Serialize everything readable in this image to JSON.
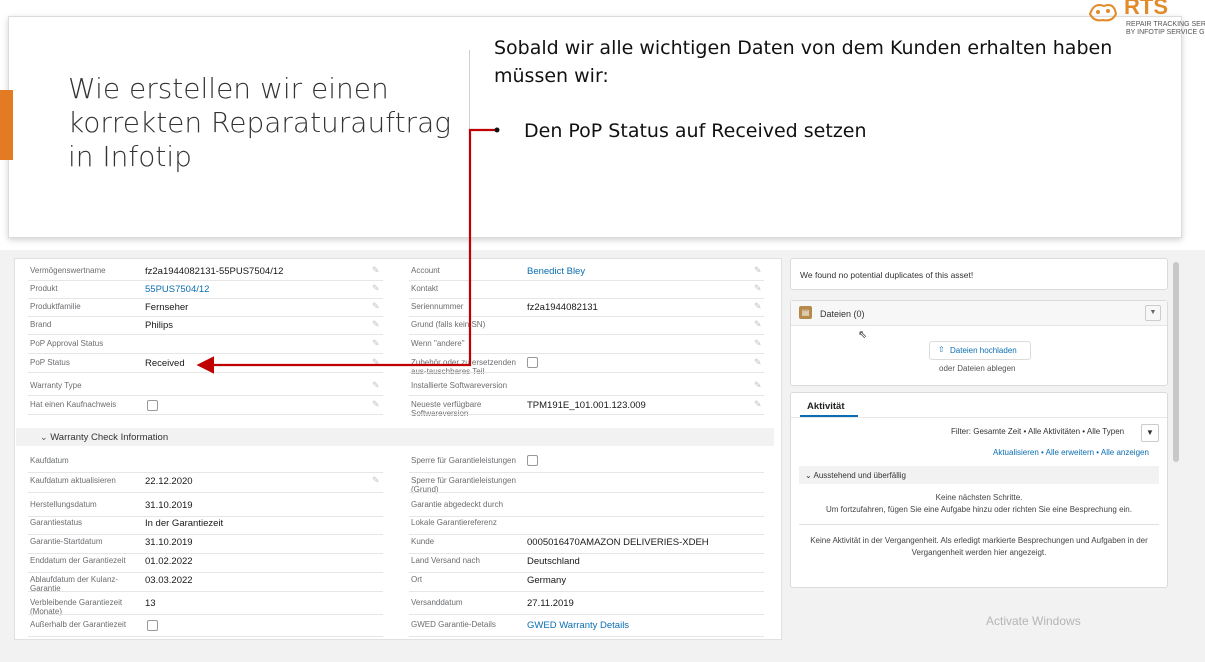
{
  "slide": {
    "title": "Wie erstellen wir einen korrekten Reparaturauftrag in Infotip",
    "intro_line1": "Sobald wir alle wichtigen Daten von dem Kunden erhalten haben",
    "intro_line2": "müssen wir:",
    "bullet": "Den PoP Status auf Received setzen",
    "accent_color": "#e37b24",
    "arrow_color": "#c00000"
  },
  "logo": {
    "name": "RTS",
    "line1": "REPAIR TRACKING SER",
    "line2": "BY INFOTIP SERVICE G"
  },
  "left_fields": [
    {
      "label": "Vermögenswertname",
      "value": "fz2a1944082131-55PUS7504/12"
    },
    {
      "label": "Produkt",
      "value": "55PUS7504/12",
      "link": true
    },
    {
      "label": "Produktfamilie",
      "value": "Fernseher"
    },
    {
      "label": "Brand",
      "value": "Philips"
    },
    {
      "label": "PoP Approval Status",
      "value": ""
    },
    {
      "label": "PoP Status",
      "value": "Received"
    },
    {
      "label": "Warranty Type",
      "value": ""
    },
    {
      "label": "Hat einen Kaufnachweis",
      "value": ""
    }
  ],
  "right_fields": [
    {
      "label": "Account",
      "value": "Benedict Bley",
      "link": true
    },
    {
      "label": "Kontakt",
      "value": ""
    },
    {
      "label": "Seriennummer",
      "value": "fz2a1944082131"
    },
    {
      "label": "Grund (falls kein SN)",
      "value": ""
    },
    {
      "label": "Wenn \"andere\"",
      "value": ""
    },
    {
      "label": "Zubehör oder zu ersetzenden aus-tauschbares Teil",
      "value": ""
    },
    {
      "label": "Installierte Softwareversion",
      "value": ""
    },
    {
      "label": "Neueste verfügbare Softwareversion",
      "value": "TPM191E_101.001.123.009"
    }
  ],
  "warranty_section": {
    "title": "Warranty Check Information",
    "left": [
      {
        "label": "Kaufdatum",
        "value": ""
      },
      {
        "label": "Kaufdatum aktualisieren",
        "value": "22.12.2020"
      },
      {
        "label": "Herstellungsdatum",
        "value": "31.10.2019"
      },
      {
        "label": "Garantiestatus",
        "value": "In der Garantiezeit"
      },
      {
        "label": "Garantie-Startdatum",
        "value": "31.10.2019"
      },
      {
        "label": "Enddatum der Garantiezeit",
        "value": "01.02.2022"
      },
      {
        "label": "Ablaufdatum der Kulanz-Garantie",
        "value": "03.03.2022"
      },
      {
        "label": "Verbleibende Garantiezeit (Monate)",
        "value": "13"
      },
      {
        "label": "Außerhalb der Garantiezeit",
        "value": ""
      }
    ],
    "right": [
      {
        "label": "Sperre für Garantieleistungen",
        "value": ""
      },
      {
        "label": "Sperre für Garantieleistungen (Grund)",
        "value": ""
      },
      {
        "label": "Garantie abgedeckt durch",
        "value": ""
      },
      {
        "label": "Lokale Garantiereferenz",
        "value": ""
      },
      {
        "label": "Kunde",
        "value": "0005016470AMAZON DELIVERIES-XDEH"
      },
      {
        "label": "Land Versand nach",
        "value": "Deutschland"
      },
      {
        "label": "Ort",
        "value": "Germany"
      },
      {
        "label": "Versanddatum",
        "value": "27.11.2019"
      },
      {
        "label": "GWED Garantie-Details",
        "value": "GWED Warranty Details",
        "link": true
      }
    ]
  },
  "sidebar": {
    "duplicates": "We found no potential duplicates of this asset!",
    "files_title": "Dateien (0)",
    "upload_button": "Dateien hochladen",
    "drop_text": "oder Dateien ablegen",
    "activity_tab": "Aktivität",
    "filter_text": "Filter: Gesamte Zeit • Alle Aktivitäten • Alle Typen",
    "links": "Aktualisieren • Alle erweitern • Alle anzeigen",
    "pending_title": "Ausstehend und überfällig",
    "next_steps_1": "Keine nächsten Schritte.",
    "next_steps_2": "Um fortzufahren, fügen Sie eine Aufgabe hinzu oder richten Sie eine Besprechung ein.",
    "past_1": "Keine Aktivität in der Vergangenheit. Als erledigt markierte Besprechungen und Aufgaben in der",
    "past_2": "Vergangenheit werden hier angezeigt."
  },
  "watermark": "Activate Windows"
}
